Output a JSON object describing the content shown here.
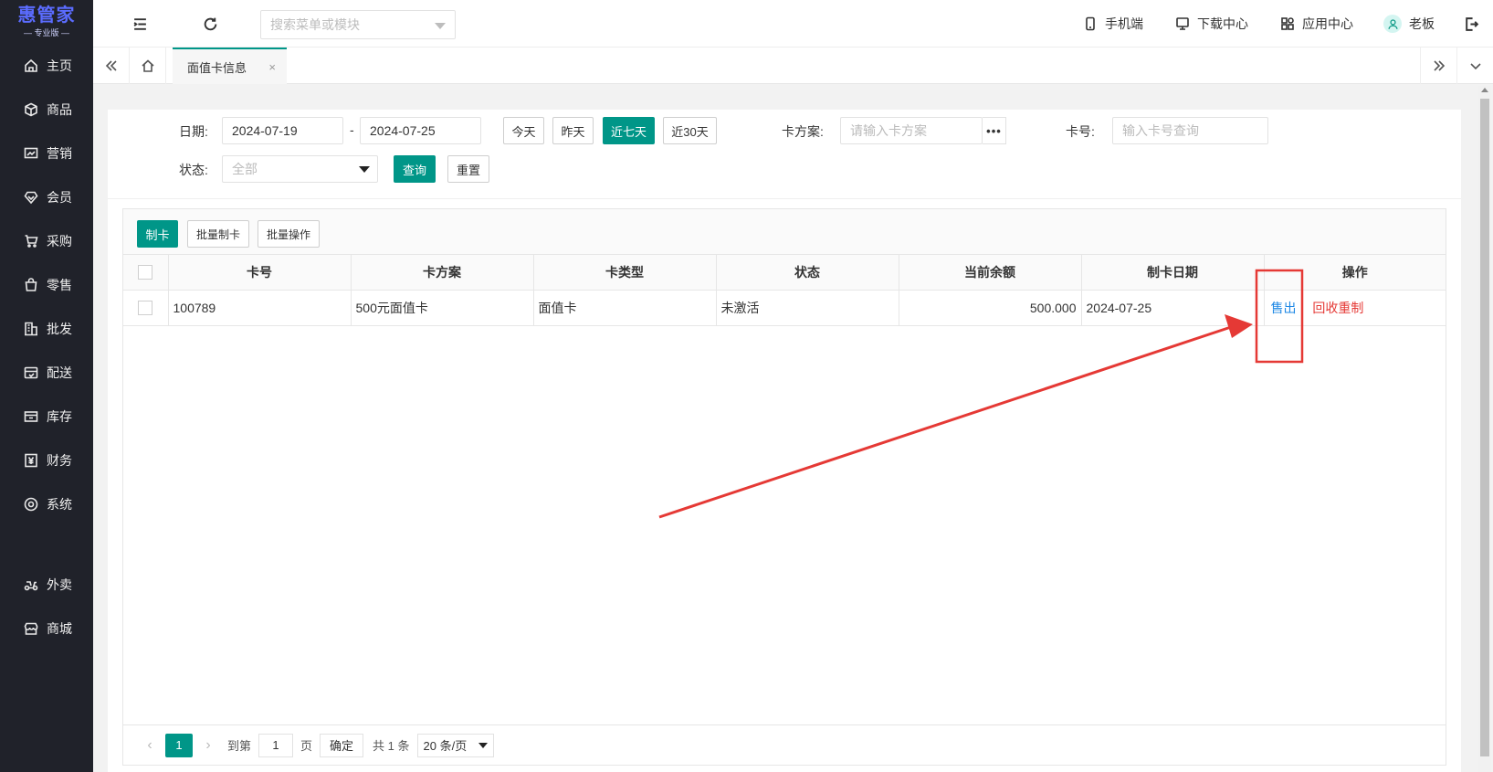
{
  "brand": {
    "name": "惠管家",
    "edition": "— 专业版 —"
  },
  "sidebar": {
    "items": [
      {
        "label": "主页",
        "icon": "home-icon"
      },
      {
        "label": "商品",
        "icon": "box-icon"
      },
      {
        "label": "营销",
        "icon": "chart-icon"
      },
      {
        "label": "会员",
        "icon": "diamond-icon"
      },
      {
        "label": "采购",
        "icon": "cart-icon"
      },
      {
        "label": "零售",
        "icon": "bag-icon"
      },
      {
        "label": "批发",
        "icon": "building-icon"
      },
      {
        "label": "配送",
        "icon": "truck-icon"
      },
      {
        "label": "库存",
        "icon": "warehouse-icon"
      },
      {
        "label": "财务",
        "icon": "yen-icon"
      },
      {
        "label": "系统",
        "icon": "gear-icon"
      }
    ],
    "extra_items": [
      {
        "label": "外卖",
        "icon": "scooter-icon"
      },
      {
        "label": "商城",
        "icon": "shop-icon"
      }
    ]
  },
  "header": {
    "search_placeholder": "搜索菜单或模块",
    "links": {
      "mobile": "手机端",
      "download": "下载中心",
      "apps": "应用中心",
      "user": "老板"
    }
  },
  "tabs": {
    "active": "面值卡信息",
    "close": "×"
  },
  "filter": {
    "date_label": "日期:",
    "date_from": "2024-07-19",
    "date_sep": "-",
    "date_to": "2024-07-25",
    "quick": {
      "today": "今天",
      "yesterday": "昨天",
      "last7": "近七天",
      "last30": "近30天"
    },
    "plan_label": "卡方案:",
    "plan_placeholder": "请输入卡方案",
    "plan_more": "•••",
    "cardno_label": "卡号:",
    "cardno_placeholder": "输入卡号查询",
    "status_label": "状态:",
    "status_value": "全部",
    "search_btn": "查询",
    "reset_btn": "重置"
  },
  "toolbar": {
    "make": "制卡",
    "batch_make": "批量制卡",
    "batch_op": "批量操作"
  },
  "table": {
    "headers": {
      "card_no": "卡号",
      "plan": "卡方案",
      "type": "卡类型",
      "status": "状态",
      "balance": "当前余额",
      "date": "制卡日期",
      "ops": "操作"
    },
    "rows": [
      {
        "card_no": "100789",
        "plan": "500元面值卡",
        "type": "面值卡",
        "status": "未激活",
        "balance": "500.000",
        "date": "2024-07-25",
        "op_sell": "售出",
        "op_reset": "回收重制"
      }
    ]
  },
  "pager": {
    "prev": "‹",
    "current": "1",
    "next": "›",
    "goto_label": "到第",
    "goto_value": "1",
    "page_unit": "页",
    "confirm": "确定",
    "total": "共 1 条",
    "page_size": "20 条/页"
  },
  "colors": {
    "primary": "#009688",
    "sidebar_bg": "#20222a",
    "link_blue": "#1e88e5",
    "danger": "#e53935",
    "annotation": "#e53935"
  }
}
